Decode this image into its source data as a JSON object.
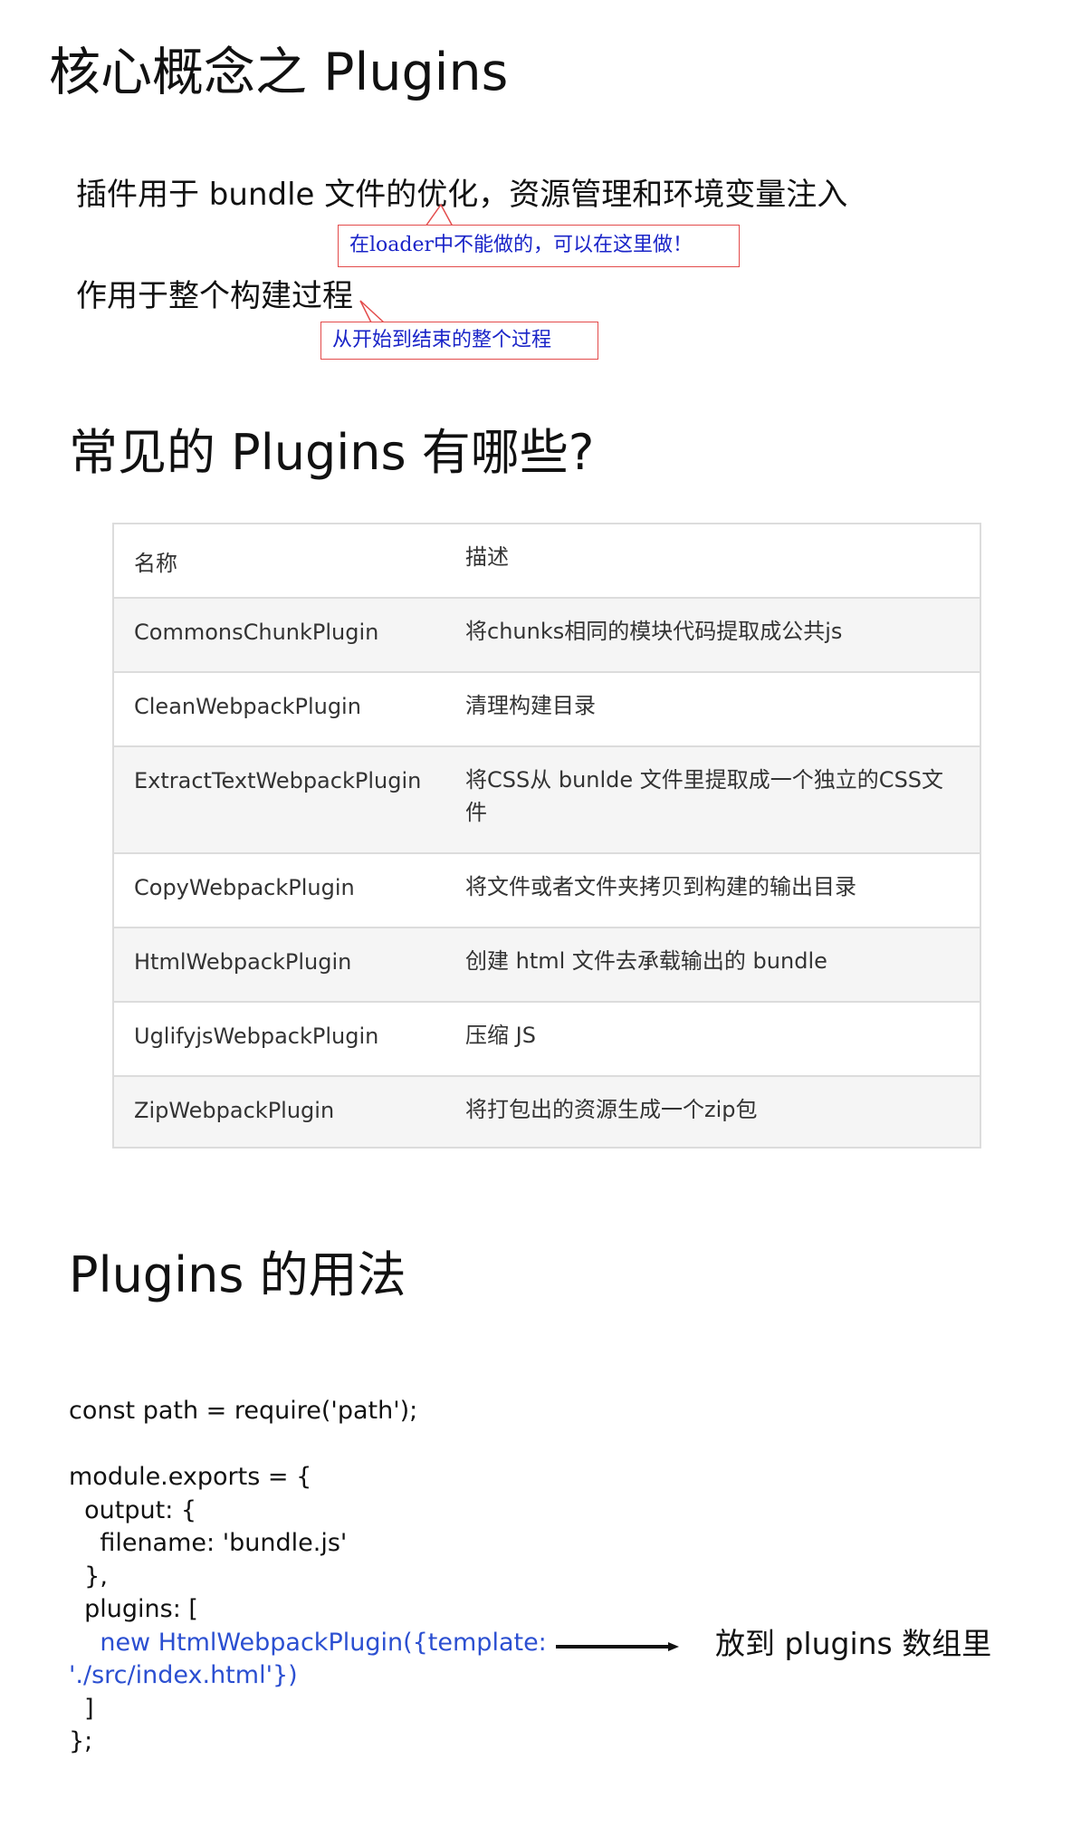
{
  "section1": {
    "title": "核心概念之 Plugins",
    "desc1": "插件用于 bundle 文件的优化，资源管理和环境变量注入",
    "callout1": "在loader中不能做的，可以在这里做！",
    "desc2": "作用于整个构建过程",
    "callout2": "从开始到结束的整个过程"
  },
  "section2": {
    "title": "常见的 Plugins 有哪些?",
    "table": {
      "headers": [
        "名称",
        "描述"
      ],
      "rows": [
        {
          "name": "CommonsChunkPlugin",
          "desc": "将chunks相同的模块代码提取成公共js"
        },
        {
          "name": "CleanWebpackPlugin",
          "desc": "清理构建目录"
        },
        {
          "name": "ExtractTextWebpackPlugin",
          "desc": "将CSS从 bunlde 文件里提取成一个独立的CSS文件"
        },
        {
          "name": "CopyWebpackPlugin",
          "desc": "将文件或者文件夹拷贝到构建的输出目录"
        },
        {
          "name": "HtmlWebpackPlugin",
          "desc": "创建 html 文件去承载输出的 bundle"
        },
        {
          "name": "UglifyjsWebpackPlugin",
          "desc": "压缩 JS"
        },
        {
          "name": "ZipWebpackPlugin",
          "desc": "将打包出的资源生成一个zip包"
        }
      ]
    }
  },
  "section3": {
    "title": "Plugins 的用法",
    "code": [
      "const path = require('path');",
      "",
      "module.exports = {",
      "  output: {",
      "    filename: 'bundle.js'",
      "  },",
      "  plugins: [",
      "    new HtmlWebpackPlugin({template:",
      "'./src/index.html'})",
      "  ]",
      "};"
    ],
    "arrow_label": "放到 plugins 数组里"
  }
}
